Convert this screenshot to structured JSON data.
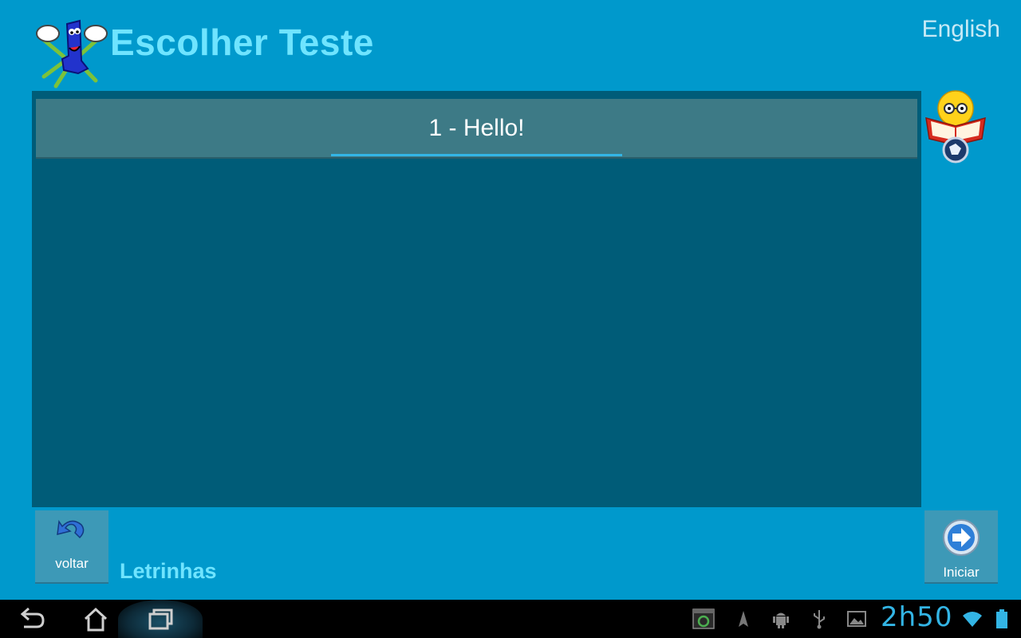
{
  "header": {
    "title": "Escolher Teste",
    "language_link": "English"
  },
  "test_list": {
    "items": [
      {
        "label": "1 - Hello!",
        "selected": true
      }
    ]
  },
  "footer": {
    "back_label": "voltar",
    "app_name": "Letrinhas",
    "start_label": "Iniciar"
  },
  "system_bar": {
    "clock": "2h50",
    "nav_icons": [
      "back-icon",
      "home-icon",
      "recents-icon"
    ],
    "status_icons": [
      "screenshot-icon",
      "navigation-icon",
      "android-debug-icon",
      "usb-icon",
      "gallery-icon",
      "wifi-icon",
      "battery-icon"
    ]
  },
  "colors": {
    "background": "#0099cc",
    "title": "#6fe4ff",
    "panel": "#005c78",
    "list_item": "#3d7a86",
    "accent": "#33b5e5",
    "system_bar": "#000000"
  }
}
